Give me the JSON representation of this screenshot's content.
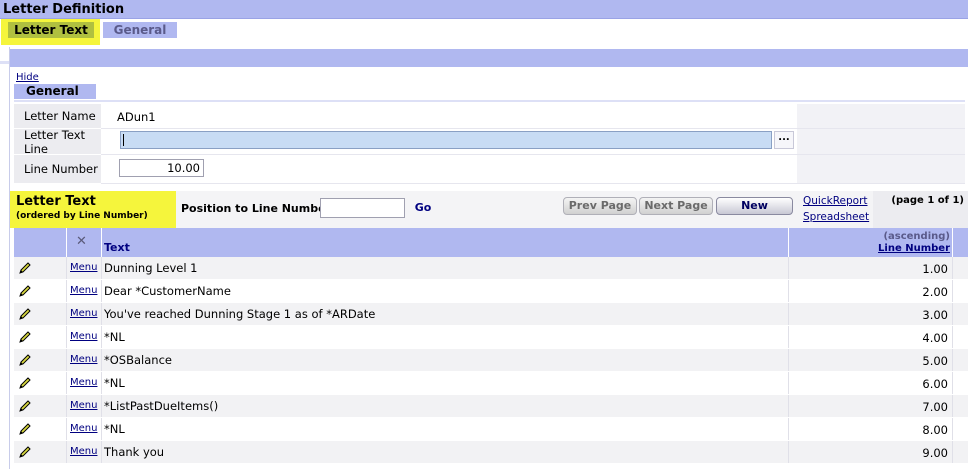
{
  "window": {
    "title": "Letter Definition"
  },
  "tabs": [
    {
      "label": "Letter Text"
    },
    {
      "label": "General"
    }
  ],
  "general_section": {
    "hide_link": "Hide",
    "title": "General",
    "letter_name_label": "Letter Name",
    "letter_name_value": "ADun1",
    "letter_text_line_label": "Letter Text Line",
    "letter_text_line_value": "",
    "ellipsis_label": "...",
    "line_number_label": "Line Number",
    "line_number_value": "10.00"
  },
  "list": {
    "title": "Letter Text",
    "subtitle": "(ordered by Line Number)",
    "position_label": "Position to Line Number",
    "position_value": "",
    "go_label": "Go",
    "prev_page_label": "Prev Page",
    "next_page_label": "Next Page",
    "new_label": "New",
    "quickreport_label": "QuickReport",
    "spreadsheet_label": "Spreadsheet",
    "page_info": "(page 1 of 1)",
    "columns": {
      "text": "Text",
      "sort_note": "(ascending)",
      "line_number": "Line Number"
    },
    "menu_label": "Menu",
    "rows": [
      {
        "text": "Dunning Level 1",
        "line": "1.00"
      },
      {
        "text": "Dear *CustomerName",
        "line": "2.00"
      },
      {
        "text": "You've reached Dunning Stage 1 as of *ARDate",
        "line": "3.00"
      },
      {
        "text": "*NL",
        "line": "4.00"
      },
      {
        "text": "*OSBalance",
        "line": "5.00"
      },
      {
        "text": "*NL",
        "line": "6.00"
      },
      {
        "text": "*ListPastDueItems()",
        "line": "7.00"
      },
      {
        "text": "*NL",
        "line": "8.00"
      },
      {
        "text": "Thank you",
        "line": "9.00"
      }
    ]
  },
  "colors": {
    "header_band": "#b0b8f0",
    "highlight": "#f5f53c",
    "active_tab": "#b0c040",
    "link": "#000080"
  }
}
